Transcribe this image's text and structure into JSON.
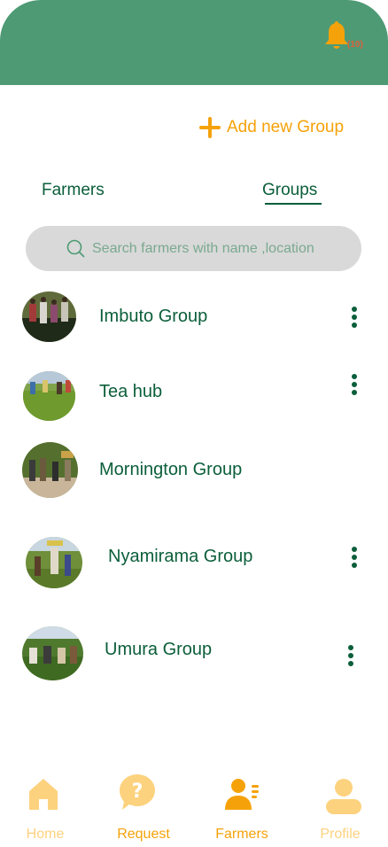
{
  "header": {
    "notification_count": "(10)",
    "colors": {
      "background": "#4e9a75",
      "bell": "#f5a20a"
    }
  },
  "actions": {
    "add_group_label": "Add new Group"
  },
  "tabs": [
    {
      "label": "Farmers",
      "active": false
    },
    {
      "label": "Groups",
      "active": true
    }
  ],
  "search": {
    "placeholder": "Search farmers with name ,location"
  },
  "groups": [
    {
      "name": "Imbuto Group",
      "has_menu": true
    },
    {
      "name": "Tea hub",
      "has_menu": true
    },
    {
      "name": "Mornington Group",
      "has_menu": false
    },
    {
      "name": "Nyamirama Group",
      "has_menu": true
    },
    {
      "name": "Umura Group",
      "has_menu": true
    }
  ],
  "bottom_nav": [
    {
      "label": "Home",
      "icon": "home-icon",
      "active": false
    },
    {
      "label": "Request",
      "icon": "question-bubble-icon",
      "active": false
    },
    {
      "label": "Farmers",
      "icon": "farmers-icon",
      "active": true
    },
    {
      "label": "Profile",
      "icon": "profile-icon",
      "active": false
    }
  ],
  "colors": {
    "accent": "#f5a20a",
    "accent_light": "#fdd27e",
    "text_green": "#0b5e3a",
    "search_bg": "#d9d9d9"
  }
}
